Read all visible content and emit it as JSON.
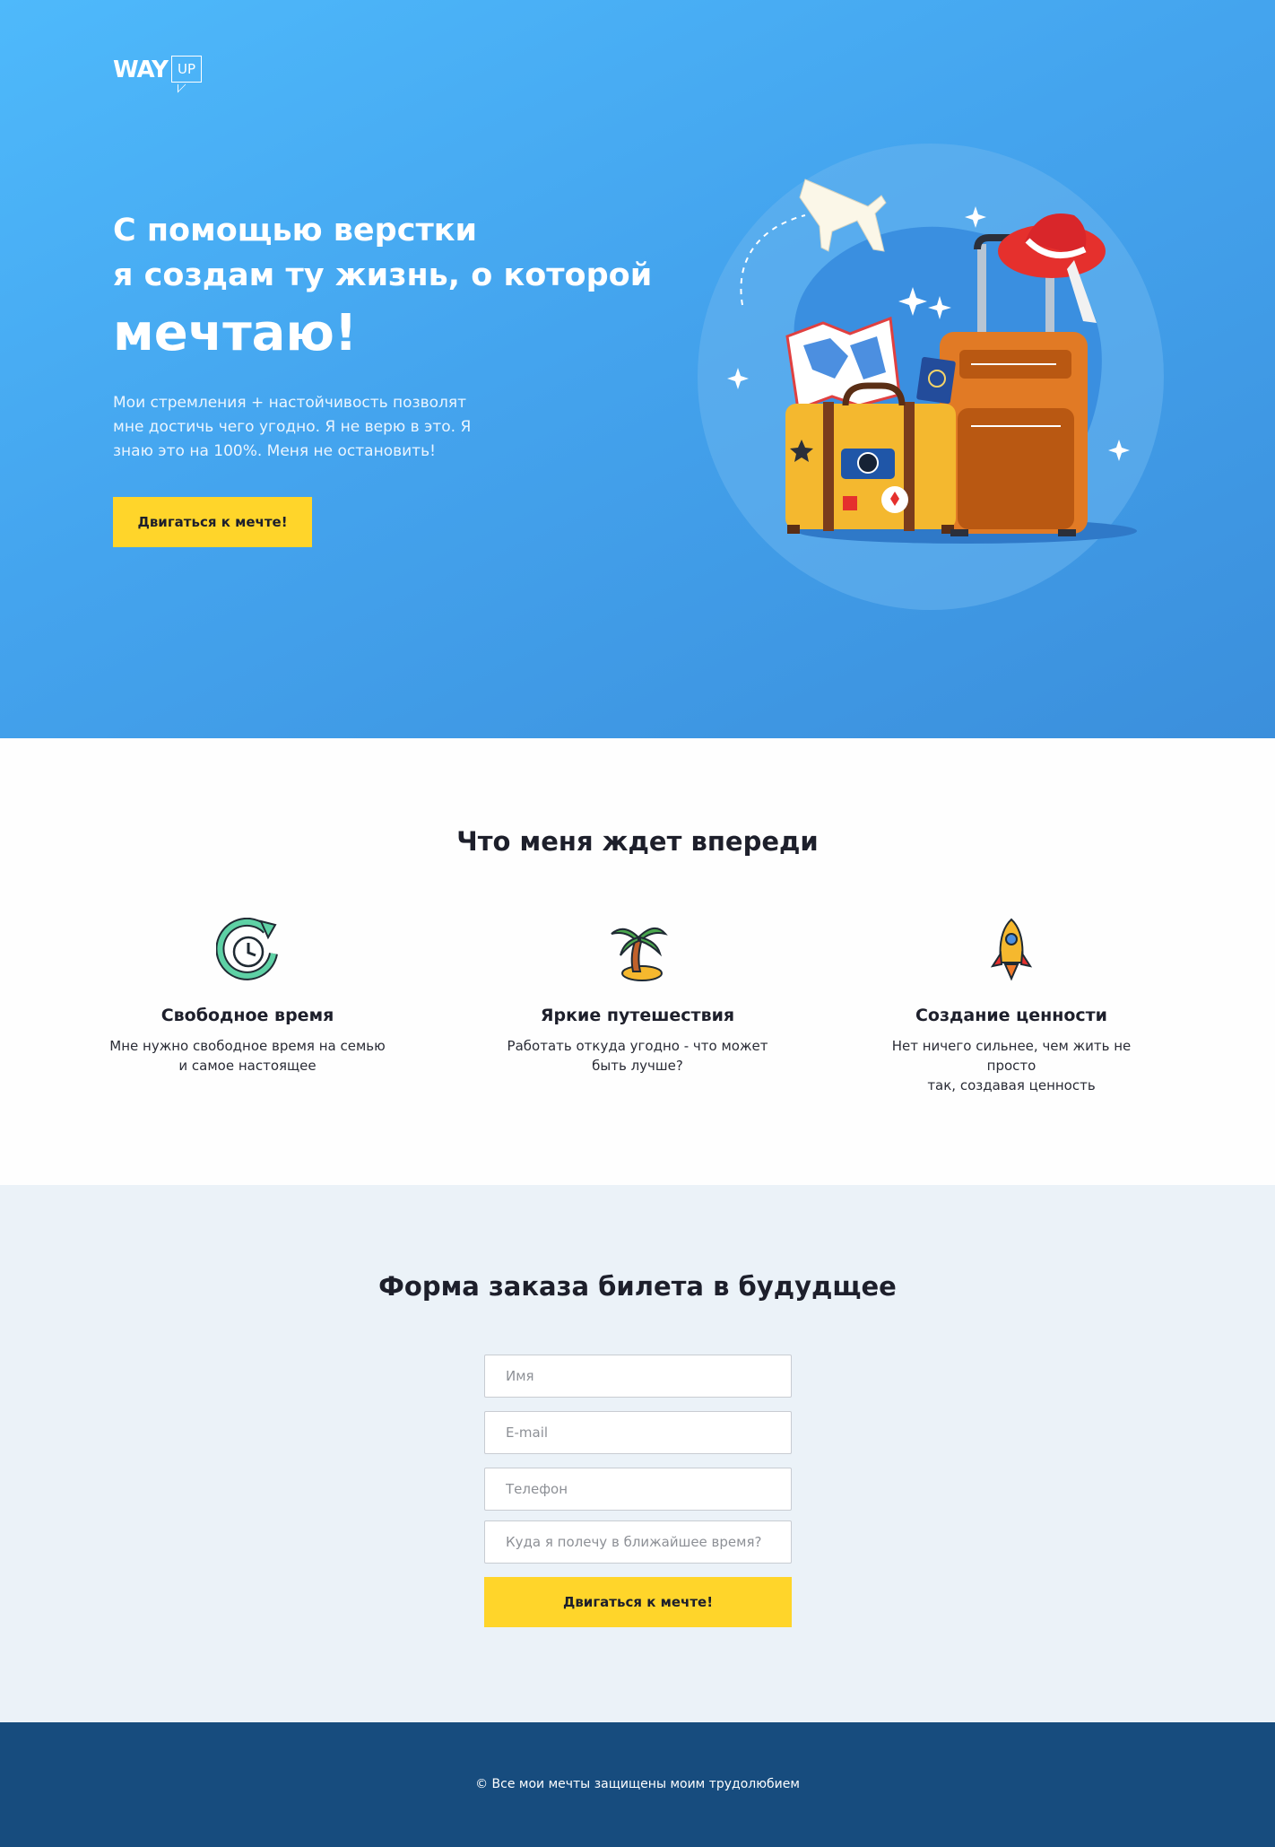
{
  "hero": {
    "logo_text": "WAY",
    "logo_box": "UP",
    "title_line1": "С помощью верстки",
    "title_line2": "я создам ту жизнь, о которой",
    "title_big": "мечтаю!",
    "description": "Мои стремления + настойчивость позволят мне достичь чего угодно. Я не верю в это. Я знаю это на 100%. Меня не остановить!",
    "cta_label": "Двигаться к мечте!"
  },
  "features": {
    "title": "Что меня ждет впереди",
    "items": [
      {
        "icon": "clock-refresh-icon",
        "name": "Свободное время",
        "desc_line1": "Мне нужно свободное время на семью",
        "desc_line2": "и самое настоящее"
      },
      {
        "icon": "palm-tree-icon",
        "name": "Яркие путешествия",
        "desc_line1": "Работать откуда угодно - что может",
        "desc_line2": "быть лучше?"
      },
      {
        "icon": "rocket-icon",
        "name": "Создание ценности",
        "desc_line1": "Нет ничего сильнее, чем жить не просто",
        "desc_line2": "так, создавая ценность"
      }
    ]
  },
  "form": {
    "title": "Форма заказа билета в будудщее",
    "name_placeholder": "Имя",
    "email_placeholder": "E-mail",
    "phone_placeholder": "Телефон",
    "destination_placeholder": "Куда я полечу в ближайшее время?",
    "submit_label": "Двигаться к мечте!"
  },
  "footer": {
    "copyright": "© Все мои мечты защищены моим трудолюбием"
  },
  "colors": {
    "hero_start": "#4eb9fb",
    "hero_end": "#3b8fdc",
    "accent_yellow": "#ffd52a",
    "form_bg": "#ebf2f8",
    "footer_bg": "#174c7e"
  }
}
